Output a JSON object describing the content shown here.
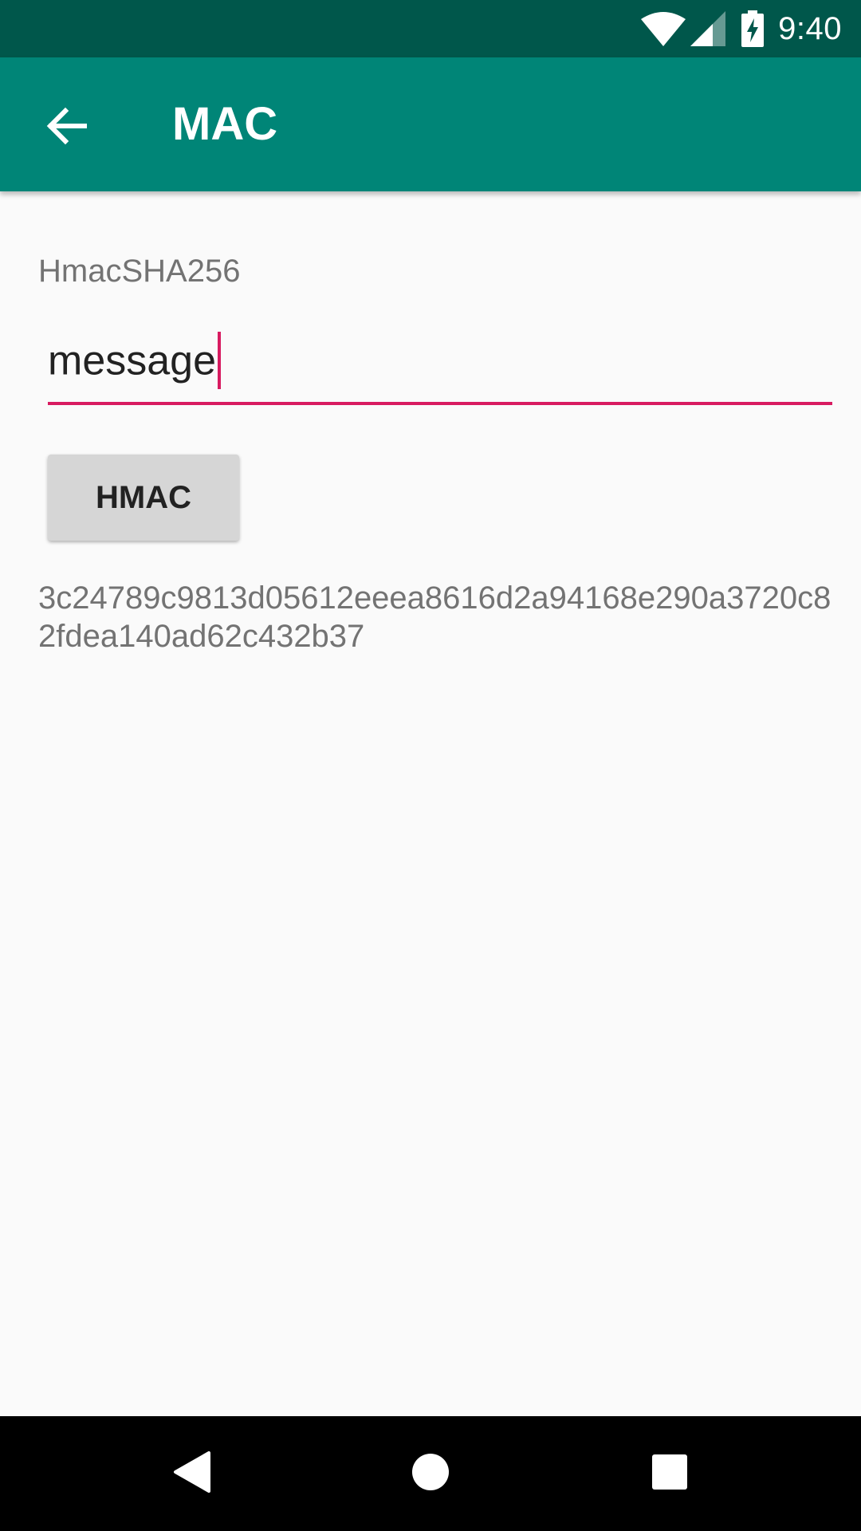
{
  "status_bar": {
    "time": "9:40",
    "icons": [
      "wifi-icon",
      "cell-signal-icon",
      "battery-charging-icon"
    ]
  },
  "app_bar": {
    "title": "MAC",
    "back_icon": "arrow-back-icon"
  },
  "form": {
    "algorithm_label": "HmacSHA256",
    "message_value": "message",
    "button_label": "HMAC",
    "result": "3c24789c9813d05612eeea8616d2a94168e290a3720c82fdea140ad62c432b37"
  },
  "nav_bar": {
    "icons": [
      "back-triangle-icon",
      "home-circle-icon",
      "recents-square-icon"
    ]
  },
  "colors": {
    "status_bar": "#00574b",
    "app_bar": "#008577",
    "accent": "#d81b60",
    "background": "#fafafa"
  }
}
